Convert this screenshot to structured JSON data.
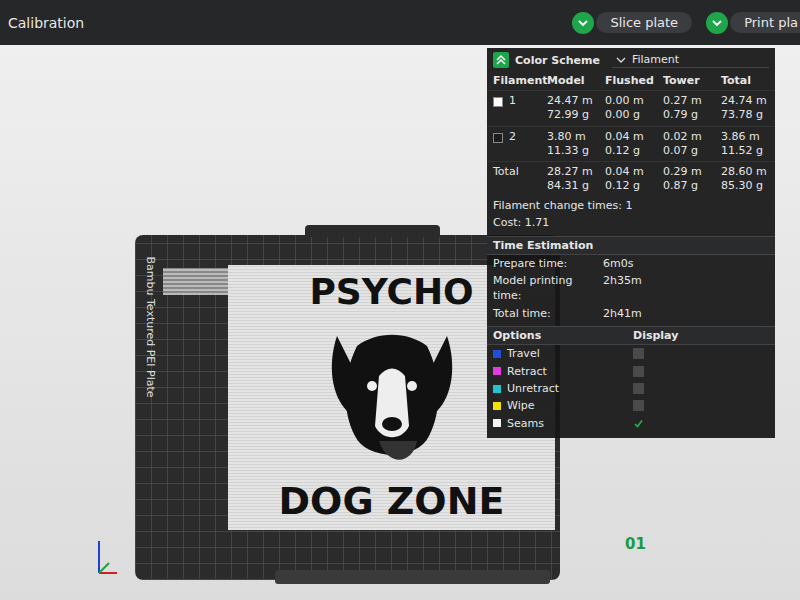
{
  "window": {
    "title": "Calibration"
  },
  "toolbar": {
    "buttons": [
      {
        "label": "Slice plate"
      },
      {
        "label": "Print pla"
      }
    ]
  },
  "viewport": {
    "plate_label": "Bambu Textured PEI Plate",
    "plate_number": "01",
    "model_texts": [
      "PSYCHO",
      "DOG ZONE"
    ]
  },
  "stats_panel": {
    "color_scheme": {
      "label": "Color Scheme",
      "value": "Filament",
      "expanded": true
    },
    "columns": [
      "Filament",
      "Model",
      "Flushed",
      "Tower",
      "Total"
    ],
    "rows": [
      {
        "label": "1",
        "color": "#ffffff",
        "cells": [
          [
            "24.47 m",
            "72.99 g"
          ],
          [
            "0.00 m",
            "0.00 g"
          ],
          [
            "0.27 m",
            "0.79 g"
          ],
          [
            "24.74 m",
            "73.78 g"
          ]
        ]
      },
      {
        "label": "2",
        "color": "#1e1e1e",
        "cells": [
          [
            "3.80 m",
            "11.33 g"
          ],
          [
            "0.04 m",
            "0.12 g"
          ],
          [
            "0.02 m",
            "0.07 g"
          ],
          [
            "3.86 m",
            "11.52 g"
          ]
        ]
      }
    ],
    "total": {
      "label": "Total",
      "cells": [
        [
          "28.27 m",
          "84.31 g"
        ],
        [
          "0.04 m",
          "0.12 g"
        ],
        [
          "0.29 m",
          "0.87 g"
        ],
        [
          "28.60 m",
          "85.30 g"
        ]
      ]
    },
    "filament_change": "Filament change times:  1",
    "cost": "Cost:  1.71",
    "time_estimation": {
      "title": "Time Estimation",
      "items": [
        {
          "label": "Prepare time:",
          "value": "6m0s"
        },
        {
          "label": "Model printing time:",
          "value": "2h35m"
        },
        {
          "label": "Total time:",
          "value": "2h41m"
        }
      ]
    },
    "options": {
      "title": "Options",
      "display_label": "Display",
      "items": [
        {
          "label": "Travel",
          "color": "#1f4fd8",
          "checked": false
        },
        {
          "label": "Retract",
          "color": "#e03ce0",
          "checked": false
        },
        {
          "label": "Unretract",
          "color": "#1fc4d0",
          "checked": false
        },
        {
          "label": "Wipe",
          "color": "#f2e200",
          "checked": false
        },
        {
          "label": "Seams",
          "color": "#f4f4f4",
          "checked": true
        }
      ]
    }
  }
}
